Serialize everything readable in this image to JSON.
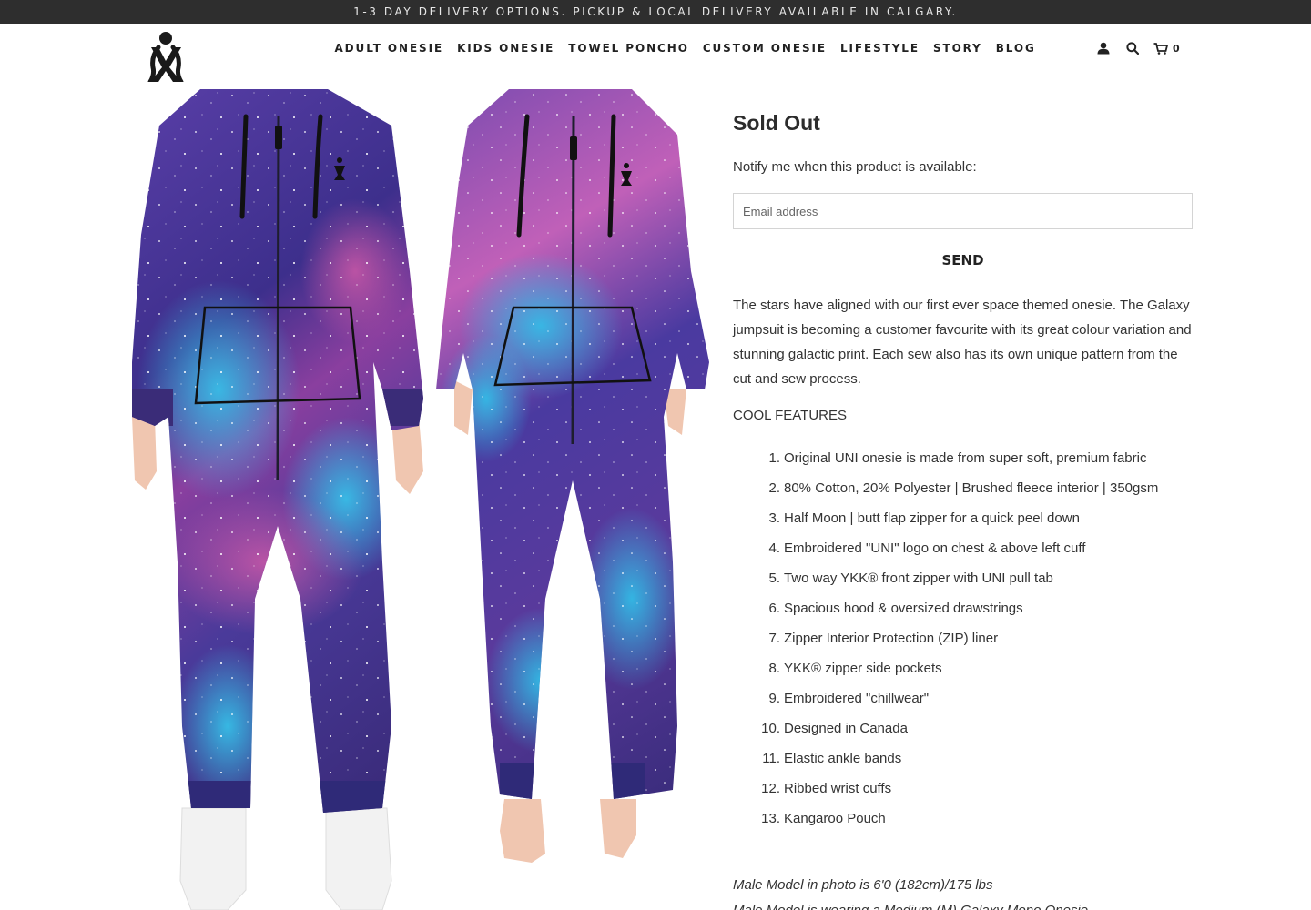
{
  "announcement": "1-3 DAY DELIVERY OPTIONS. PICKUP & LOCAL DELIVERY AVAILABLE IN CALGARY.",
  "nav": {
    "items": [
      "ADULT ONESIE",
      "KIDS ONESIE",
      "TOWEL PONCHO",
      "CUSTOM ONESIE",
      "LIFESTYLE",
      "STORY",
      "BLOG"
    ]
  },
  "tools": {
    "account_icon": "user-icon",
    "search_icon": "search-icon",
    "cart_icon": "cart-icon",
    "cart_count": "0"
  },
  "product": {
    "status": "Sold Out",
    "notify_label": "Notify me when this product is available:",
    "email_placeholder": "Email address",
    "send_label": "SEND",
    "description": "The stars have aligned with our first ever space themed onesie. The Galaxy jumpsuit is becoming a customer favourite with its great colour variation and stunning galactic print. Each sew also has its own unique pattern from the cut and sew process.",
    "features_title": "COOL FEATURES",
    "features": [
      "Original UNI onesie is made from super soft, premium fabric",
      "80% Cotton, 20% Polyester | Brushed fleece interior | 350gsm",
      "Half Moon | butt flap zipper for a quick peel down",
      "Embroidered \"UNI\" logo on chest & above left cuff",
      "Two way YKK® front zipper with UNI pull tab",
      "Spacious hood & oversized drawstrings",
      "Zipper Interior Protection (ZIP) liner",
      "YKK® zipper side pockets",
      "Embroidered \"chillwear\"",
      "Designed in Canada",
      "Elastic ankle bands",
      "Ribbed wrist cuffs",
      "Kangaroo Pouch"
    ],
    "model_note": "Male Model in photo is  6'0 (182cm)/175 lbs",
    "model_note_2": "Male Model is wearing a Medium (M) Galaxy Mono Onesie"
  },
  "colors": {
    "announce_bg": "#2e2e2e",
    "galaxy_purple": "#5b3c9c",
    "galaxy_cyan": "#2fb8e0",
    "galaxy_pink": "#b0459a"
  }
}
